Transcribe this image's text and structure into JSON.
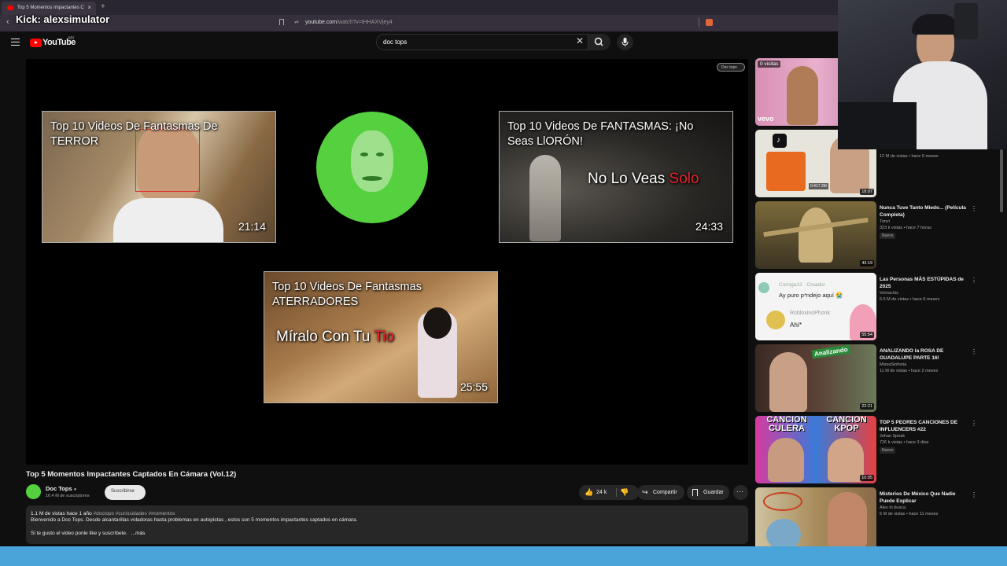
{
  "overlay": {
    "kick_label": "Kick: alexsimulator"
  },
  "browser": {
    "tab_title": "Top 5 Momentos Impactantes C",
    "url_host": "youtube.com",
    "url_path": "/watch?v=tHHAXVjey4"
  },
  "header": {
    "logo_text": "YouTube",
    "region": "MX",
    "search_value": "doc tops"
  },
  "player": {
    "badge": "Doc tops",
    "endcards": [
      {
        "title": "Top 10 Videos De Fantasmas De TERROR",
        "duration": "21:14"
      },
      {
        "title": "Top 10 Videos De FANTASMAS: ¡No Seas LlORÓN!",
        "duration": "24:33",
        "overlay_text": "No Lo Veas ",
        "overlay_red": "Solo"
      },
      {
        "title": "Top 10 Videos De Fantasmas ATERRADORES",
        "duration": "25:55",
        "overlay_text": "Míralo Con Tu ",
        "overlay_red": "Tio"
      }
    ]
  },
  "video": {
    "title": "Top 5 Momentos Impactantes Captados En Cámara (Vol.12)",
    "channel": "Doc Tops",
    "subscribers": "16.4 M de suscriptores",
    "subscribe_label": "Suscribirse",
    "likes": "24 k",
    "share_label": "Compartir",
    "save_label": "Guardar",
    "desc_meta": "1.1 M de vistas  hace 1 año ",
    "desc_tags": "#doctops #curiosidades #momentos",
    "desc_line1": "Bienvenido a Doc Tops.  Desde alcantarillas voladoras hasta problemas en autopistas , estos son 5 momentos impactantes captados en cámara.",
    "desc_line2": "Si te gusto el video ponle like y suscríbete.",
    "more_label": "...más"
  },
  "sidebar": {
    "items": [
      {
        "views_badge": "0 visitas",
        "brand": "vevo"
      },
      {
        "title": "",
        "channel": "",
        "meta": "12 M de vistas • hace 6 meses",
        "duration": "18:07",
        "overlay": "0:417.3M"
      },
      {
        "title": "Nunca Tuve Tanto Miedo... (Película Completa)",
        "channel": "Tonvi",
        "meta": "323 k vistas • hace 7 horas",
        "new": "Nuevo",
        "duration": "43:19"
      },
      {
        "title": "Las Personas MÁS ESTÚPIDAS de 2025",
        "channel": "Vomachis",
        "meta": "6.5 M de vistas • hace 6 meses",
        "duration": "55:54",
        "comment_user": "Comiga13 · Creador",
        "comment_text": "Ay puro p*ndejo aquí 😭",
        "reply_user": "RobloxinoPhonk",
        "reply_text": "Ahí*"
      },
      {
        "title": "ANALIZANDO la ROSA DE GUADALUPE PARTE 16!",
        "channel": "MissaSinfonia",
        "meta": "11 M de vistas • hace 2 meses",
        "duration": "22:21",
        "thumb_text": "Analizando"
      },
      {
        "title": "TOP 5 PEORES CANCIONES DE INFLUENCERS #22",
        "channel": "Johan Speak",
        "meta": "726 k vistas • hace 3 días",
        "new": "Nuevo",
        "duration": "10:05",
        "thumb_left": "CANCION CULERA",
        "thumb_right": "CANCION KPOP"
      },
      {
        "title": "Misterios De México Que Nadie Puede Explicar",
        "channel": "Alex Io busca",
        "meta": "5 M de vistas • hace 11 meses",
        "duration": ""
      }
    ]
  },
  "colors": {
    "accent_red": "#ff0000",
    "kick_band": "#4aa3d9",
    "channel_green": "#55d03f"
  }
}
